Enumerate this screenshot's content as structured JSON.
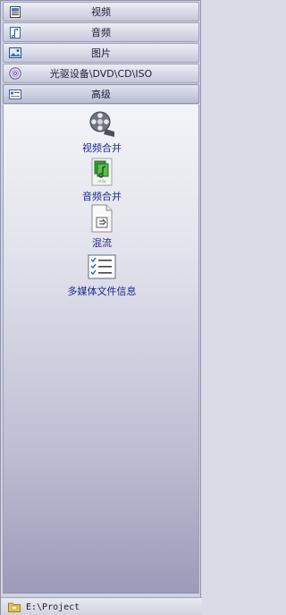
{
  "categories": [
    {
      "label": "视频",
      "icon": "video-file-icon"
    },
    {
      "label": "音频",
      "icon": "audio-file-icon"
    },
    {
      "label": "图片",
      "icon": "image-file-icon"
    },
    {
      "label": "光驱设备\\DVD\\CD\\ISO",
      "icon": "disc-icon"
    },
    {
      "label": "高级",
      "icon": "advanced-icon"
    }
  ],
  "active_category": "高级",
  "tools": [
    {
      "label": "视频合并",
      "icon": "film-reel-icon"
    },
    {
      "label": "音频合并",
      "icon": "music-merge-icon"
    },
    {
      "label": "混流",
      "icon": "mux-document-icon"
    },
    {
      "label": "多媒体文件信息",
      "icon": "checklist-icon"
    }
  ],
  "status_bar": {
    "path": "E:\\Project",
    "icon": "folder-icon"
  }
}
